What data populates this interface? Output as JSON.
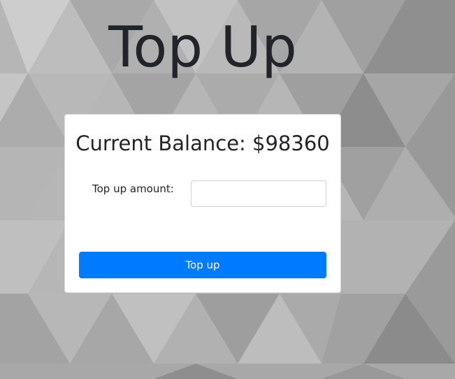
{
  "page": {
    "title": "Top Up"
  },
  "card": {
    "balance_label": "Current Balance:",
    "balance_value": "$98360",
    "amount_label": "Top up amount:",
    "amount_value": "",
    "amount_placeholder": "",
    "button_label": "Top up"
  },
  "colors": {
    "accent": "#007bff",
    "text": "#212529",
    "background": "#b4b4b4"
  }
}
